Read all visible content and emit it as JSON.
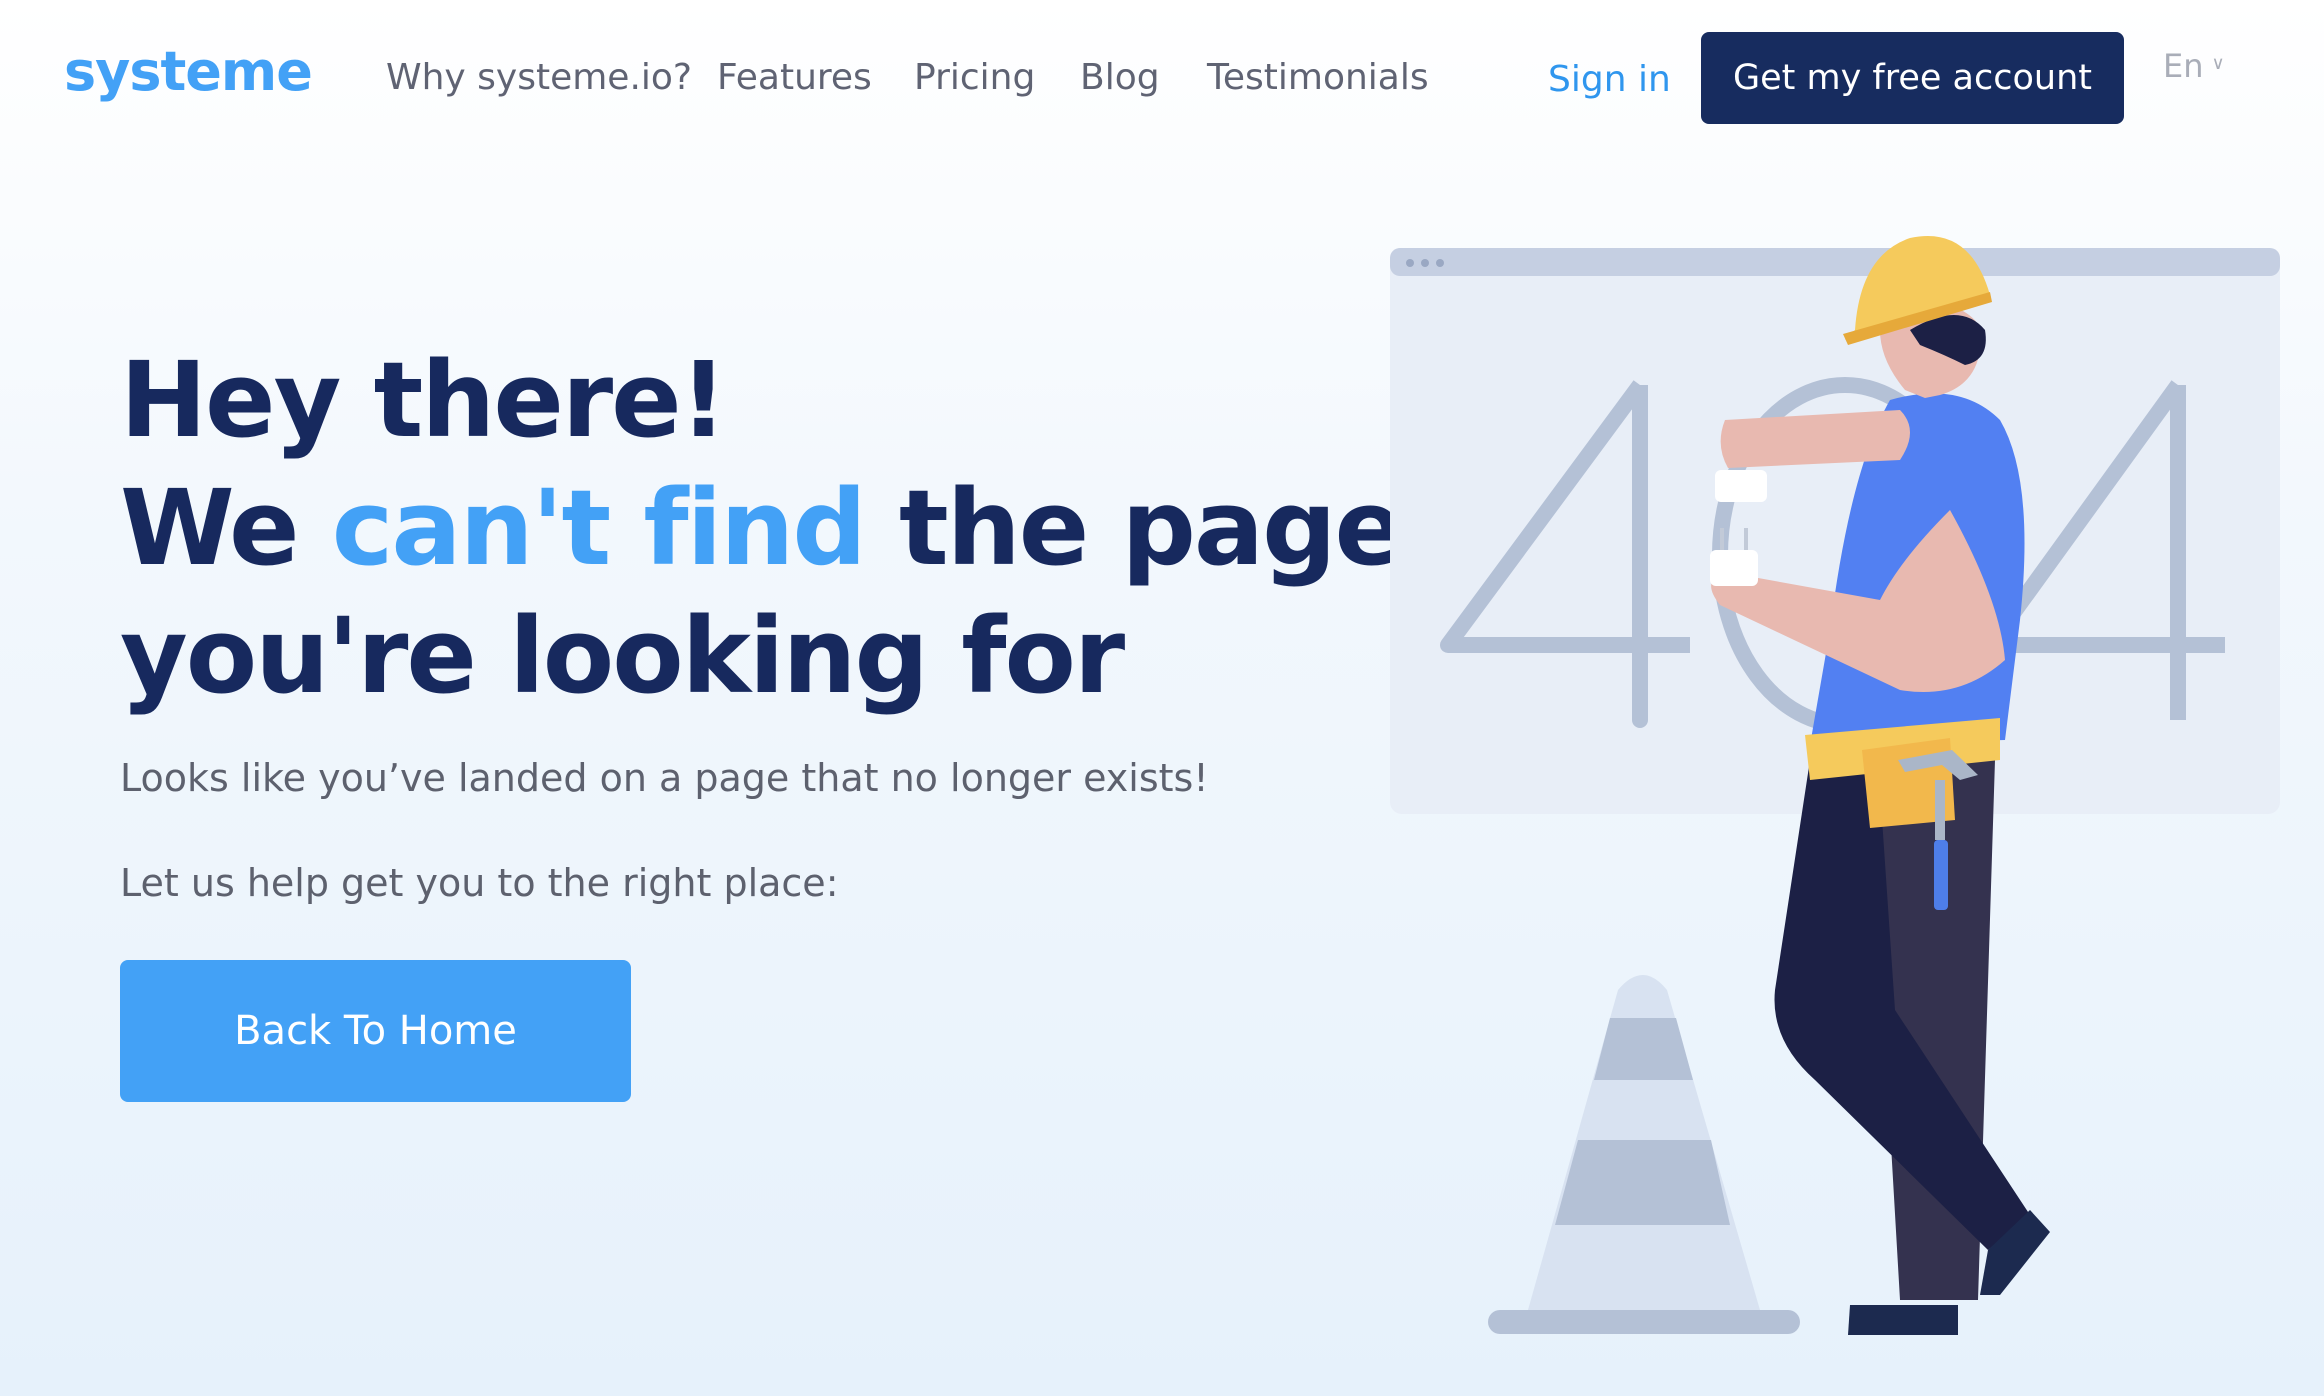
{
  "brand": {
    "logo_text": "systeme"
  },
  "nav": {
    "items": [
      {
        "label": "Why systeme.io?"
      },
      {
        "label": "Features"
      },
      {
        "label": "Pricing"
      },
      {
        "label": "Blog"
      },
      {
        "label": "Testimonials"
      }
    ],
    "sign_in": "Sign in",
    "cta": "Get my free account",
    "language": "En"
  },
  "hero": {
    "line1": "Hey there!",
    "line2_before": "We ",
    "line2_highlight": "can't find",
    "line2_after": " the page",
    "line3": "you're looking for",
    "message": "Looks like you’ve landed on a page that no longer exists!",
    "help": "Let us help get you to the right place:",
    "button": "Back To Home"
  },
  "illustration": {
    "error_code": "404"
  },
  "colors": {
    "brand_blue": "#43a1f6",
    "navy": "#172c5f",
    "text_gray": "#5f6373"
  },
  "icons": [
    "chevron-down-icon",
    "construction-worker-illustration",
    "traffic-cone-illustration",
    "hammer-icon"
  ]
}
